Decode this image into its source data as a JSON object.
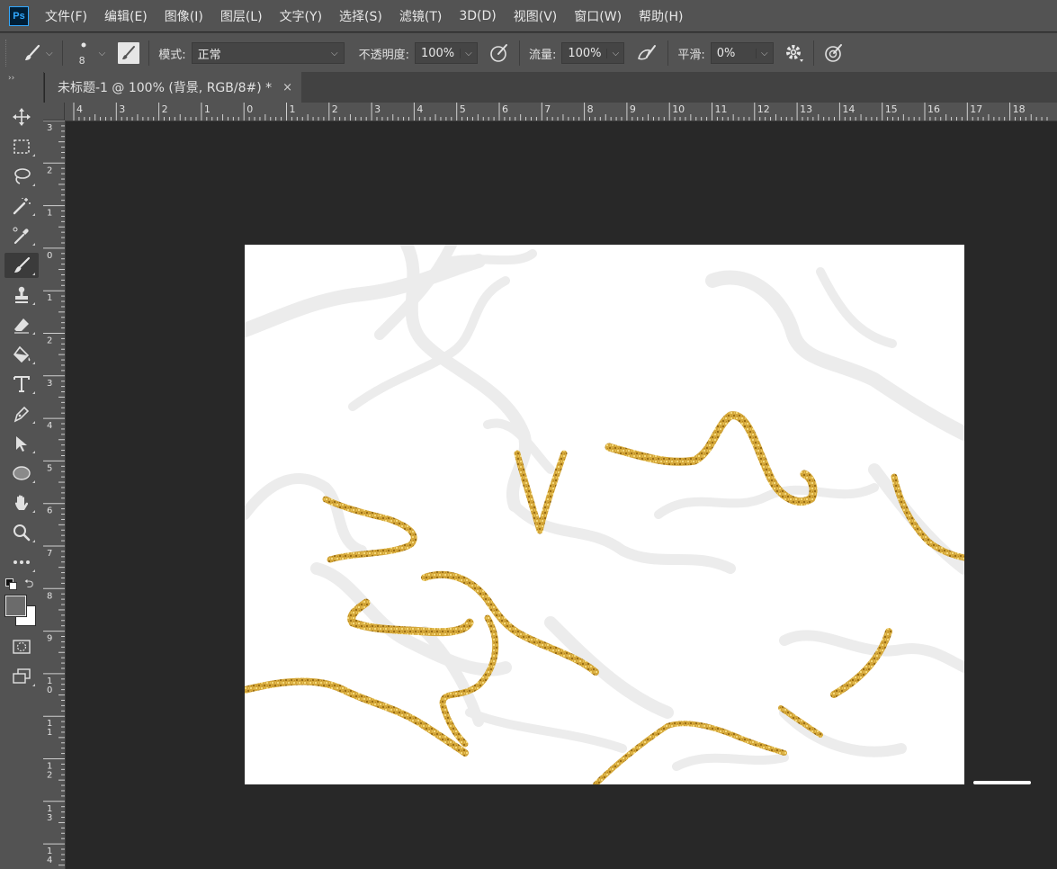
{
  "app": {
    "logo_text": "Ps"
  },
  "menu": [
    "文件(F)",
    "编辑(E)",
    "图像(I)",
    "图层(L)",
    "文字(Y)",
    "选择(S)",
    "滤镜(T)",
    "3D(D)",
    "视图(V)",
    "窗口(W)",
    "帮助(H)"
  ],
  "options": {
    "brush_size": "8",
    "mode_label": "模式:",
    "mode_value": "正常",
    "opacity_label": "不透明度:",
    "opacity_value": "100%",
    "flow_label": "流量:",
    "flow_value": "100%",
    "smooth_label": "平滑:",
    "smooth_value": "0%"
  },
  "document": {
    "tab_title": "未标题-1 @ 100% (背景, RGB/8#) *",
    "close_glyph": "×"
  },
  "ruler": {
    "horizontal": [
      "4",
      "3",
      "2",
      "1",
      "0",
      "1",
      "2",
      "3",
      "4",
      "5",
      "6",
      "7",
      "8",
      "9",
      "10",
      "11",
      "12",
      "13",
      "14",
      "15",
      "16",
      "17",
      "18"
    ],
    "vertical": [
      "3",
      "2",
      "1",
      "0",
      "1",
      "2",
      "3",
      "4",
      "5",
      "6",
      "7",
      "8",
      "9",
      "10",
      "11",
      "12",
      "13",
      "14"
    ]
  },
  "tools": [
    {
      "name": "move-tool",
      "icon": "move-icon"
    },
    {
      "name": "marquee-tool",
      "icon": "marquee-icon"
    },
    {
      "name": "lasso-tool",
      "icon": "lasso-icon"
    },
    {
      "name": "magic-wand-tool",
      "icon": "magic-wand-icon"
    },
    {
      "name": "eyedropper-tool",
      "icon": "eyedropper-icon"
    },
    {
      "name": "brush-tool",
      "icon": "brush-icon",
      "active": true
    },
    {
      "name": "stamp-tool",
      "icon": "stamp-icon"
    },
    {
      "name": "eraser-tool",
      "icon": "eraser-icon"
    },
    {
      "name": "paint-bucket-tool",
      "icon": "paint-bucket-icon"
    },
    {
      "name": "type-tool",
      "icon": "type-icon"
    },
    {
      "name": "pen-tool",
      "icon": "pen-icon"
    },
    {
      "name": "path-select-tool",
      "icon": "arrow-icon"
    },
    {
      "name": "ellipse-tool",
      "icon": "ellipse-icon"
    },
    {
      "name": "hand-tool",
      "icon": "hand-icon"
    },
    {
      "name": "zoom-tool",
      "icon": "zoom-icon"
    },
    {
      "name": "more-tools",
      "icon": "ellipsis-icon"
    }
  ],
  "colors": {
    "foreground": "#6b6b6b",
    "background": "#ffffff",
    "gold": "#c99a2a",
    "marble": "#ececec"
  }
}
